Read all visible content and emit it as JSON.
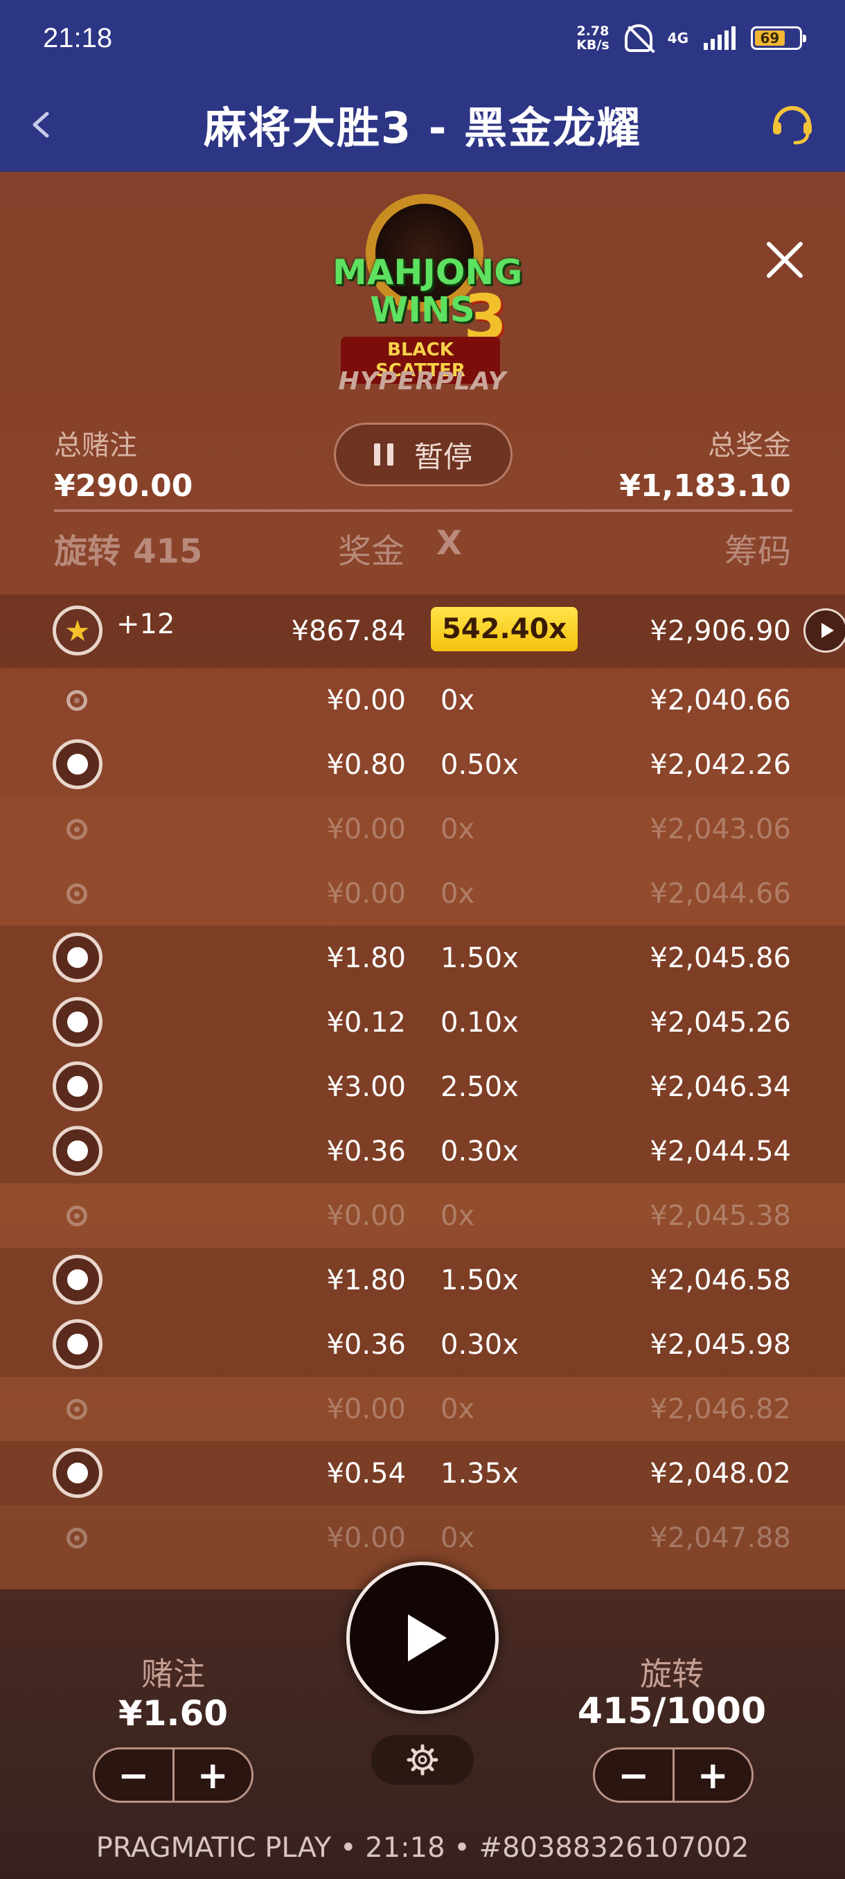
{
  "status_bar": {
    "time": "21:18",
    "net_speed_value": "2.78",
    "net_speed_unit": "KB/s",
    "network_type": "4G",
    "battery": "69"
  },
  "app_bar": {
    "title": "麻将大胜3 - 黑金龙耀"
  },
  "game": {
    "logo": {
      "line1": "MAHJONG",
      "line2": "WINS",
      "number": "3",
      "line3": "BLACK SCATTER"
    },
    "brand": "HYPERPLAY",
    "total_bet_label": "总赌注",
    "total_bet_value": "¥290.00",
    "total_win_label": "总奖金",
    "total_win_value": "¥1,183.10",
    "pause_label": "暂停",
    "columns": {
      "spin": "旋转",
      "spin_count": "415",
      "prize": "奖金",
      "multiplier": "X",
      "chips": "筹码"
    },
    "top_row": {
      "extra": "+12",
      "prize": "¥867.84",
      "multiplier": "542.40x",
      "chips": "¥2,906.90"
    },
    "rows": [
      {
        "prize": "¥0.00",
        "mult": "0x",
        "chips": "¥2,040.66"
      },
      {
        "prize": "¥0.80",
        "mult": "0.50x",
        "chips": "¥2,042.26"
      },
      {
        "prize": "¥0.00",
        "mult": "0x",
        "chips": "¥2,043.06"
      },
      {
        "prize": "¥0.00",
        "mult": "0x",
        "chips": "¥2,044.66"
      },
      {
        "prize": "¥1.80",
        "mult": "1.50x",
        "chips": "¥2,045.86"
      },
      {
        "prize": "¥0.12",
        "mult": "0.10x",
        "chips": "¥2,045.26"
      },
      {
        "prize": "¥3.00",
        "mult": "2.50x",
        "chips": "¥2,046.34"
      },
      {
        "prize": "¥0.36",
        "mult": "0.30x",
        "chips": "¥2,044.54"
      },
      {
        "prize": "¥0.00",
        "mult": "0x",
        "chips": "¥2,045.38"
      },
      {
        "prize": "¥1.80",
        "mult": "1.50x",
        "chips": "¥2,046.58"
      },
      {
        "prize": "¥0.36",
        "mult": "0.30x",
        "chips": "¥2,045.98"
      },
      {
        "prize": "¥0.00",
        "mult": "0x",
        "chips": "¥2,046.82"
      },
      {
        "prize": "¥0.54",
        "mult": "1.35x",
        "chips": "¥2,048.02"
      },
      {
        "prize": "¥0.00",
        "mult": "0x",
        "chips": "¥2,047.88"
      }
    ]
  },
  "controls": {
    "bet_label": "赌注",
    "bet_value": "¥1.60",
    "spin_label": "旋转",
    "spin_value": "415/1000",
    "minus": "−",
    "plus": "+"
  },
  "footer": "PRAGMATIC PLAY • 21:18 • #80388326107002",
  "colors": {
    "header_bg": "#2d3585",
    "panel_bg": "#8a452b",
    "badge": "#ffd62a",
    "control_bg": "#3d2520"
  }
}
